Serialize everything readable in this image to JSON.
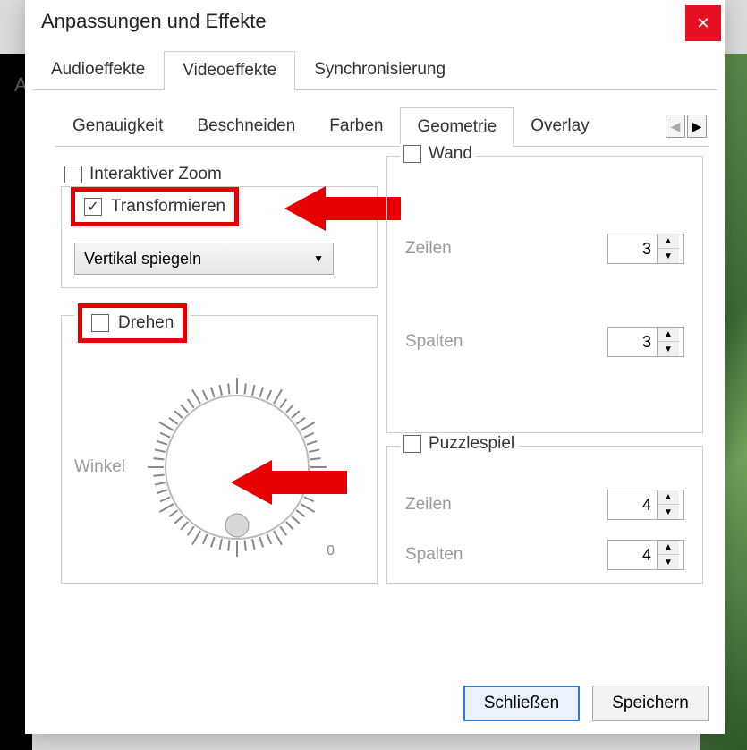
{
  "window": {
    "title": "Anpassungen und Effekte"
  },
  "bgLetter": "A",
  "mainTabs": {
    "audio": "Audioeffekte",
    "video": "Videoeffekte",
    "sync": "Synchronisierung"
  },
  "subTabs": {
    "t0": "Genauigkeit",
    "t1": "Beschneiden",
    "t2": "Farben",
    "t3": "Geometrie",
    "t4": "Overlay"
  },
  "left": {
    "interactiveZoom": "Interaktiver Zoom",
    "transform": "Transformieren",
    "transformSelect": "Vertikal spiegeln",
    "rotate": "Drehen",
    "angleLabel": "Winkel",
    "dialZero": "0"
  },
  "right": {
    "wand": "Wand",
    "rowsLabel": "Zeilen",
    "colsLabel": "Spalten",
    "wandRows": "3",
    "wandCols": "3",
    "puzzle": "Puzzlespiel",
    "puzzleRows": "4",
    "puzzleCols": "4"
  },
  "footer": {
    "close": "Schließen",
    "save": "Speichern"
  }
}
